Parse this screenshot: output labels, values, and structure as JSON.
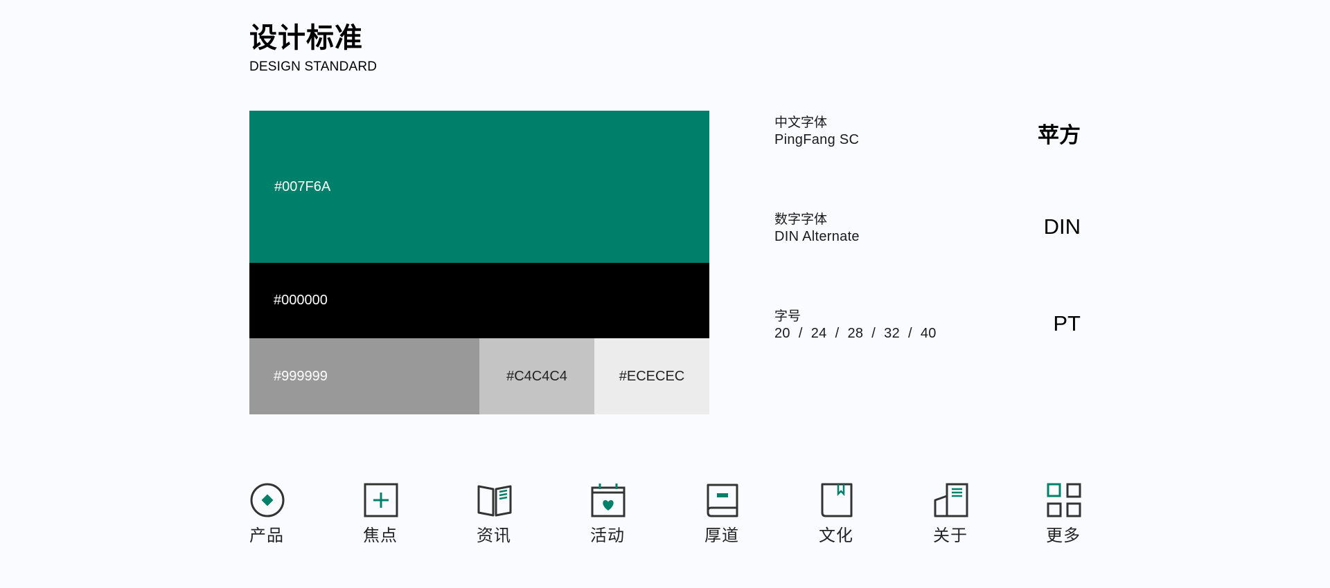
{
  "header": {
    "title": "设计标准",
    "subtitle": "DESIGN STANDARD"
  },
  "colors": {
    "primary": "#007F6A",
    "black": "#000000",
    "grey": "#999999",
    "light_grey": "#C4C4C4",
    "extra_light_grey": "#ECECEC",
    "icon_stroke": "#333333"
  },
  "swatches": [
    {
      "label": "#007F6A",
      "hex": "#007F6A",
      "text_color": "#ffffff"
    },
    {
      "label": "#000000",
      "hex": "#000000",
      "text_color": "#ffffff"
    },
    {
      "label": "#999999",
      "hex": "#999999",
      "text_color": "#ffffff"
    },
    {
      "label": "#C4C4C4",
      "hex": "#C4C4C4",
      "text_color": "#222222"
    },
    {
      "label": "#ECECEC",
      "hex": "#ECECEC",
      "text_color": "#222222"
    }
  ],
  "typography": {
    "chinese": {
      "label": "中文字体",
      "name": "PingFang SC",
      "sample": "苹方"
    },
    "numeric": {
      "label": "数字字体",
      "name": "DIN Alternate",
      "sample": "DIN"
    },
    "size": {
      "label": "字号",
      "values": [
        "20",
        "24",
        "28",
        "32",
        "40"
      ],
      "separator": "/",
      "sample": "PT"
    }
  },
  "icons": [
    {
      "icon": "product-icon",
      "label": "产品"
    },
    {
      "icon": "focus-icon",
      "label": "焦点"
    },
    {
      "icon": "news-icon",
      "label": "资讯"
    },
    {
      "icon": "activity-icon",
      "label": "活动"
    },
    {
      "icon": "houdao-icon",
      "label": "厚道"
    },
    {
      "icon": "culture-icon",
      "label": "文化"
    },
    {
      "icon": "about-icon",
      "label": "关于"
    },
    {
      "icon": "more-icon",
      "label": "更多"
    }
  ]
}
